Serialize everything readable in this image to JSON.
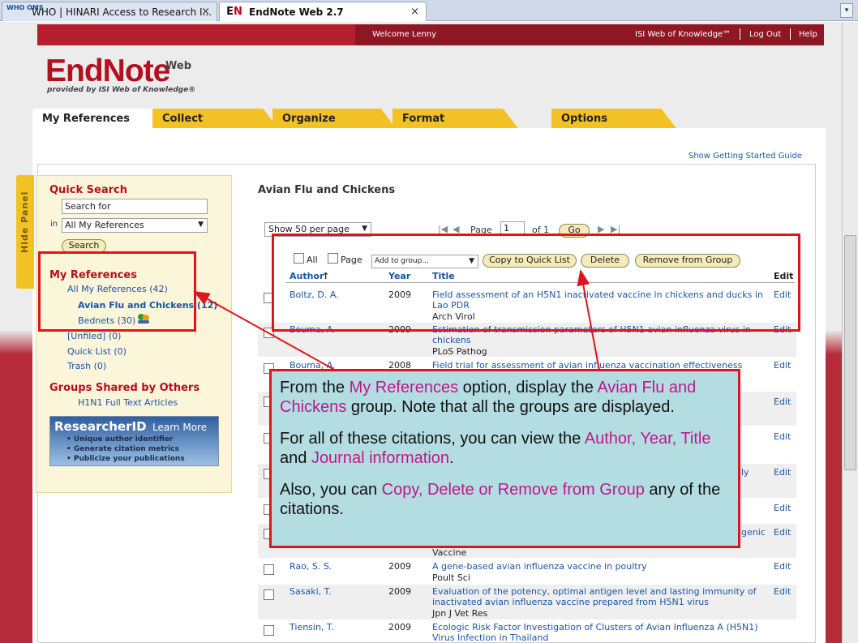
{
  "browser": {
    "tabs": [
      {
        "favicon": "WHO OMS",
        "title": "WHO | HINARI Access to Research I...",
        "close": "×"
      },
      {
        "favicon_letters": [
          "E",
          "N"
        ],
        "title": "EndNote Web 2.7",
        "close": "×"
      }
    ],
    "dropdown": "▾"
  },
  "header": {
    "welcome": "Welcome Lenny",
    "wok": "ISI Web of Knowledge℠",
    "logout": "Log Out",
    "help": "Help",
    "logo": "EndNote",
    "logo_web": "Web",
    "logo_sub": "provided by ISI Web of Knowledge®"
  },
  "nav": [
    "My References",
    "Collect",
    "Organize",
    "Format",
    "Options"
  ],
  "guide_link": "Show Getting Started Guide",
  "hide_panel": "Hide Panel",
  "left_panel": {
    "quick_search": "Quick Search",
    "search_placeholder": "Search for",
    "in_label": "in",
    "scope": "All My References",
    "search_button": "Search",
    "my_refs_heading": "My References",
    "items": [
      "All My References (42)",
      "Avian Flu and Chickens (12)",
      "Bednets (30)",
      "[Unfiled] (0)",
      "Quick List (0)",
      "Trash (0)"
    ],
    "groups_heading": "Groups Shared by Others",
    "shared_group": "H1N1 Full Text Articles",
    "researcher_id": {
      "name": "ResearcherID",
      "learn_more": "Learn More",
      "bullets": [
        "Unique author identifier",
        "Generate citation metrics",
        "Publicize your publications"
      ]
    }
  },
  "main": {
    "group_title": "Avian Flu and Chickens",
    "per_page": "Show 50 per page",
    "page_label": "Page",
    "page_value": "1",
    "of_label": "of 1",
    "go_button": "Go",
    "toolbar": {
      "all": "All",
      "page": "Page",
      "add_group": "Add to group...",
      "copy": "Copy to Quick List",
      "delete": "Delete",
      "remove": "Remove from Group"
    },
    "columns": {
      "author": "Author",
      "sort_arrow": "↑",
      "year": "Year",
      "title": "Title",
      "edit": "Edit"
    },
    "rows": [
      {
        "author": "Boltz, D. A.",
        "year": "2009",
        "title": "Field assessment of an H5N1 inactivated vaccine in chickens and ducks in Lao PDR",
        "journal": "Arch Virol",
        "edit": "Edit"
      },
      {
        "author": "Bouma, A.",
        "year": "2009",
        "title": "Estimation of transmission parameters of H5N1 avian influenza virus in chickens",
        "journal": "PLoS Pathog",
        "edit": "Edit"
      },
      {
        "author": "Bouma, A.",
        "year": "2008",
        "title": "Field trial for assessment of avian influenza vaccination effectiveness",
        "journal": "",
        "edit": "Edit"
      },
      {
        "author": "",
        "year": "",
        "title": "",
        "journal": "",
        "edit": "Edit"
      },
      {
        "author": "",
        "year": "",
        "title": "",
        "journal": "",
        "edit": "Edit"
      },
      {
        "author": "",
        "year": "",
        "title": "ly",
        "journal": "",
        "edit": "Edit"
      },
      {
        "author": "",
        "year": "",
        "title": "",
        "journal": "",
        "edit": "Edit"
      },
      {
        "author": "",
        "year": "",
        "title": "genic",
        "journal": "Vaccine",
        "edit": "Edit"
      },
      {
        "author": "Rao, S. S.",
        "year": "2009",
        "title": "A gene-based avian influenza vaccine in poultry",
        "journal": "Poult Sci",
        "edit": "Edit"
      },
      {
        "author": "Sasaki, T.",
        "year": "2009",
        "title": "Evaluation of the potency, optimal antigen level and lasting immunity of inactivated avian influenza vaccine prepared from H5N1 virus",
        "journal": "Jpn J Vet Res",
        "edit": "Edit"
      },
      {
        "author": "Tiensin, T.",
        "year": "2009",
        "title": "Ecologic Risk Factor Investigation of Clusters of Avian Influenza A (H5N1) Virus Infection in Thailand",
        "journal": "",
        "edit": ""
      }
    ]
  },
  "callout": {
    "p1": {
      "a": "From the ",
      "b": "My References",
      "c": " option, display the ",
      "d": "Avian Flu and Chickens",
      "e": " group.  Note that all the groups are displayed."
    },
    "p2": {
      "a": "For all of these citations, you can view the ",
      "b": "Author, Year, Title",
      "c": " and ",
      "d": "Journal information",
      "e": "."
    },
    "p3": {
      "a": "Also, you can ",
      "b": "Copy, Delete or Remove from Group",
      "c": " any of the citations."
    }
  },
  "colors": {
    "accent_red": "#b51e2c",
    "tab_yellow": "#f2c225",
    "link_blue": "#1a55a8",
    "annotation_red": "#e0141c",
    "highlight_magenta": "#c0168a",
    "callout_bg": "#b4dde2"
  }
}
